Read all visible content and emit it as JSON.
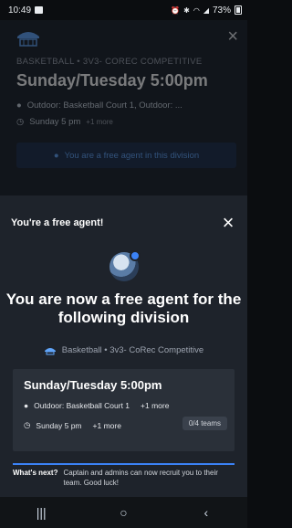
{
  "status_bar": {
    "time": "10:49",
    "battery": "73%"
  },
  "background": {
    "breadcrumb": "BASKETBALL  •  3V3- COREC COMPETITIVE",
    "title": "Sunday/Tuesday 5:00pm",
    "location": "Outdoor: Basketball Court 1, Outdoor: ...",
    "time": "Sunday 5 pm",
    "time_more": "+1 more",
    "banner": "You are a free agent in this division"
  },
  "sheet": {
    "title": "You're a free agent!",
    "headline": "You are now a free agent for the following division",
    "sport_line": "Basketball • 3v3- CoRec Competitive",
    "card": {
      "title": "Sunday/Tuesday 5:00pm",
      "location": "Outdoor: Basketball Court 1",
      "location_more": "+1 more",
      "time": "Sunday 5 pm",
      "time_more": "+1 more",
      "teams": "0/4 teams"
    },
    "next_label": "What's next?",
    "next_text": "Captain and admins can now recruit you to their team. Good luck!"
  },
  "nav": {
    "recents": "|||",
    "home": "○",
    "back": "‹"
  },
  "colors": {
    "accent": "#3b82f6",
    "sheet_bg": "#1e232b",
    "card_bg": "#2a3039"
  }
}
